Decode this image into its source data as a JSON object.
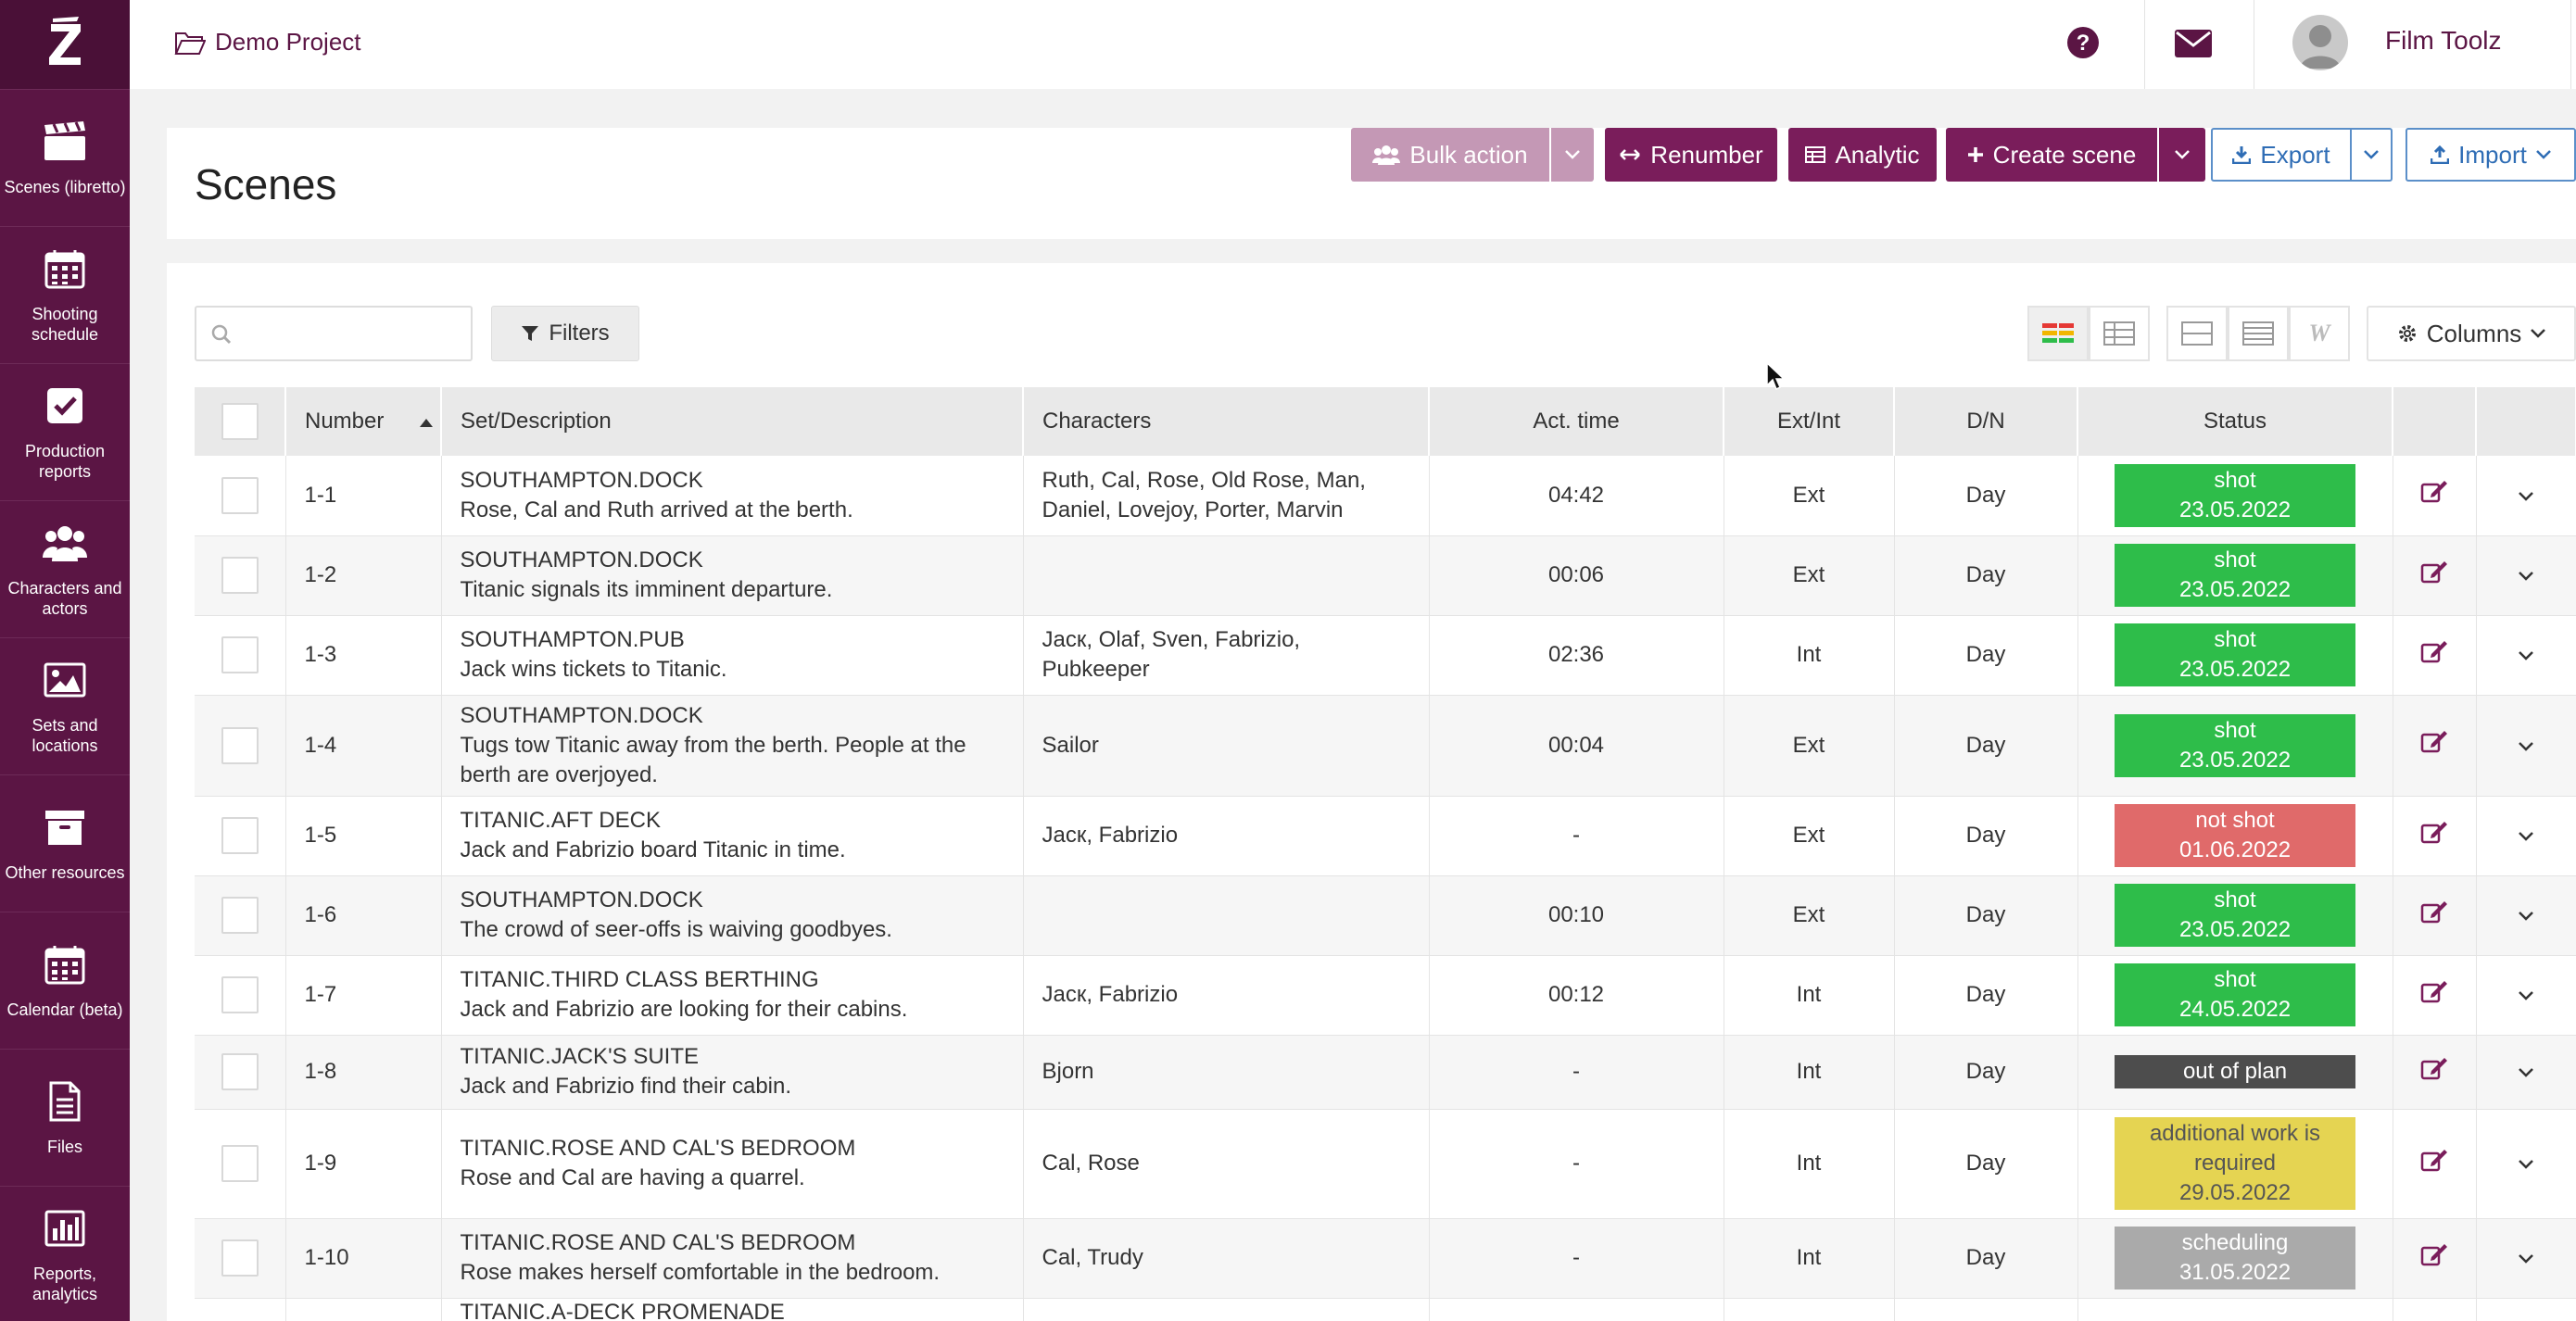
{
  "app": {
    "logo": "Z"
  },
  "sidebar": {
    "items": [
      {
        "label": "Scenes (libretto)",
        "icon": "clapperboard-icon"
      },
      {
        "label": "Shooting schedule",
        "icon": "calendar-icon"
      },
      {
        "label": "Production reports",
        "icon": "checkbox-icon"
      },
      {
        "label": "Characters and actors",
        "icon": "users-icon"
      },
      {
        "label": "Sets and locations",
        "icon": "image-icon"
      },
      {
        "label": "Other resources",
        "icon": "archive-icon"
      },
      {
        "label": "Calendar (beta)",
        "icon": "calendar-icon"
      },
      {
        "label": "Files",
        "icon": "file-icon"
      },
      {
        "label": "Reports, analytics",
        "icon": "bar-chart-icon"
      }
    ]
  },
  "topbar": {
    "project": "Demo Project",
    "user": "Film Toolz"
  },
  "header": {
    "title": "Scenes",
    "buttons": {
      "bulk_action": "Bulk action",
      "renumber": "Renumber",
      "analytic": "Analytic",
      "create_scene": "Create scene",
      "export": "Export",
      "import": "Import"
    }
  },
  "toolbar": {
    "search_placeholder": "",
    "filters": "Filters",
    "columns": "Columns"
  },
  "table": {
    "columns": [
      "Number",
      "Set/Description",
      "Characters",
      "Act. time",
      "Ext/Int",
      "D/N",
      "Status"
    ],
    "rows": [
      {
        "number": "1-1",
        "set": "SOUTHAMPTON.DOCK",
        "desc": "Rose, Cal and Ruth arrived at the berth.",
        "characters": "Ruth, Cal, Rose, Old Rose, Man, Daniel, Lovejoy, Porter, Marvin",
        "time": "04:42",
        "extint": "Ext",
        "dn": "Day",
        "status": "shot",
        "status_date": "23.05.2022",
        "status_class": "st-shot"
      },
      {
        "number": "1-2",
        "set": "SOUTHAMPTON.DOCK",
        "desc": "Titanic signals its imminent departure.",
        "characters": "",
        "time": "00:06",
        "extint": "Ext",
        "dn": "Day",
        "status": "shot",
        "status_date": "23.05.2022",
        "status_class": "st-shot"
      },
      {
        "number": "1-3",
        "set": "SOUTHAMPTON.PUB",
        "desc": "Jack wins tickets to Titanic.",
        "characters": "Jacк, Olaf, Sven, Fabrizio, Pubkeeper",
        "time": "02:36",
        "extint": "Int",
        "dn": "Day",
        "status": "shot",
        "status_date": "23.05.2022",
        "status_class": "st-shot"
      },
      {
        "number": "1-4",
        "set": "SOUTHAMPTON.DOCK",
        "desc": "Tugs tow Titanic away from the berth. People at the berth are overjoyed.",
        "characters": "Sailor",
        "time": "00:04",
        "extint": "Ext",
        "dn": "Day",
        "status": "shot",
        "status_date": "23.05.2022",
        "status_class": "st-shot"
      },
      {
        "number": "1-5",
        "set": "TITANIC.AFT DECK",
        "desc": "Jack and Fabrizio board Titanic in time.",
        "characters": "Jacк, Fabrizio",
        "time": "-",
        "extint": "Ext",
        "dn": "Day",
        "status": "not shot",
        "status_date": "01.06.2022",
        "status_class": "st-notshot"
      },
      {
        "number": "1-6",
        "set": "SOUTHAMPTON.DOCK",
        "desc": "The crowd of seer-offs is waiving goodbyes.",
        "characters": "",
        "time": "00:10",
        "extint": "Ext",
        "dn": "Day",
        "status": "shot",
        "status_date": "23.05.2022",
        "status_class": "st-shot"
      },
      {
        "number": "1-7",
        "set": "TITANIC.THIRD CLASS BERTHING",
        "desc": "Jack and Fabrizio are looking for their cabins.",
        "characters": "Jacк, Fabrizio",
        "time": "00:12",
        "extint": "Int",
        "dn": "Day",
        "status": "shot",
        "status_date": "24.05.2022",
        "status_class": "st-shot"
      },
      {
        "number": "1-8",
        "set": "TITANIC.JACK'S SUITE",
        "desc": "Jack and Fabrizio find their cabin.",
        "characters": "Bjorn",
        "time": "-",
        "extint": "Int",
        "dn": "Day",
        "status": "out of plan",
        "status_date": "",
        "status_class": "st-outofplan"
      },
      {
        "number": "1-9",
        "set": "TITANIC.ROSE AND CAL'S BEDROOM",
        "desc": "Rose and Cal are having a quarrel.",
        "characters": "Cal, Rose",
        "time": "-",
        "extint": "Int",
        "dn": "Day",
        "status": "additional work is required",
        "status_date": "29.05.2022",
        "status_class": "st-additional"
      },
      {
        "number": "1-10",
        "set": "TITANIC.ROSE AND CAL'S BEDROOM",
        "desc": "Rose makes herself comfortable in the bedroom.",
        "characters": "Cal, Trudy",
        "time": "-",
        "extint": "Int",
        "dn": "Day",
        "status": "scheduling",
        "status_date": "31.05.2022",
        "status_class": "st-scheduling"
      },
      {
        "number": "",
        "set": "TITANIC.A-DECK PROMENADE",
        "desc": "",
        "characters": "",
        "time": "",
        "extint": "",
        "dn": "",
        "status": "",
        "status_date": "",
        "status_class": ""
      }
    ]
  }
}
